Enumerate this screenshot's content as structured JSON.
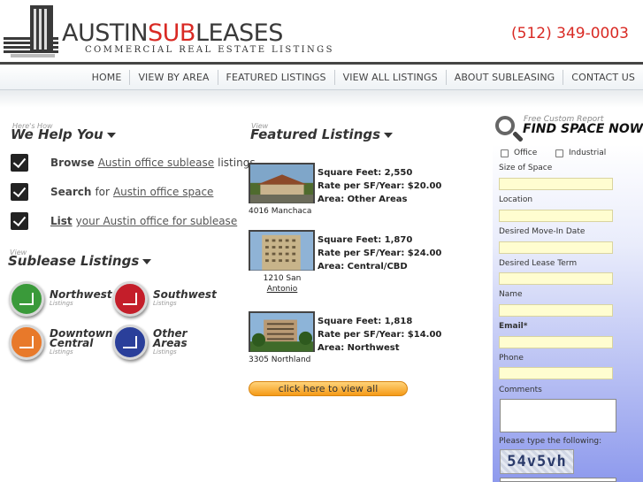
{
  "header": {
    "brand_prefix": "AUSTIN",
    "brand_accent": "SUB",
    "brand_suffix": "LEASES",
    "tagline": "COMMERCIAL REAL ESTATE LISTINGS",
    "phone": "(512) 349-0003",
    "accent_color": "#d92a24"
  },
  "nav": {
    "items": [
      "HOME",
      "VIEW BY AREA",
      "FEATURED LISTINGS",
      "VIEW ALL LISTINGS",
      "ABOUT SUBLEASING",
      "CONTACT US"
    ]
  },
  "help": {
    "overline": "Here's How",
    "title": "We  Help You",
    "rows": [
      {
        "verb": "Browse",
        "link": "Austin office sublease",
        "tail": "listings"
      },
      {
        "verb": "Search",
        "mid": "for",
        "link": "Austin office space"
      },
      {
        "verb": "List",
        "link": "your Austin office for sublease"
      }
    ]
  },
  "sublease": {
    "overline": "View",
    "title": "Sublease Listings",
    "areas": [
      {
        "name": "Northwest",
        "sub": "Listings",
        "color": "#3a9a3a"
      },
      {
        "name": "Southwest",
        "sub": "Listings",
        "color": "#c41e2a"
      },
      {
        "name1": "Downtown",
        "name2": "Central",
        "sub": "Listings",
        "color": "#e8792a"
      },
      {
        "name1": "Other",
        "name2": "Areas",
        "sub": "Listings",
        "color": "#2a3f9a"
      }
    ]
  },
  "featured": {
    "overline": "View",
    "title": "Featured Listings",
    "listings": [
      {
        "sqft": "Square Feet: 2,550",
        "rate": "Rate per SF/Year: $20.00",
        "area": "Area: Other Areas",
        "address": "4016 Manchaca"
      },
      {
        "sqft": "Square Feet: 1,870",
        "rate": "Rate per SF/Year: $24.00",
        "area": "Area: Central/CBD",
        "address_line1": "1210 San",
        "address_line2": "Antonio"
      },
      {
        "sqft": "Square Feet: 1,818",
        "rate": "Rate per SF/Year: $14.00",
        "area": "Area: Northwest",
        "address": "3305 Northland"
      }
    ],
    "view_all": "click here to view all"
  },
  "form": {
    "overline": "Free Custom Report",
    "title": "FIND SPACE NOW!",
    "options": [
      "Office",
      "Industrial"
    ],
    "fields": [
      "Size of Space",
      "Location",
      "Desired Move-In Date",
      "Desired Lease Term",
      "Name",
      "Email*",
      "Phone"
    ],
    "comments_label": "Comments",
    "captcha_label": "Please type the following:",
    "captcha_text": "54v5vh"
  }
}
